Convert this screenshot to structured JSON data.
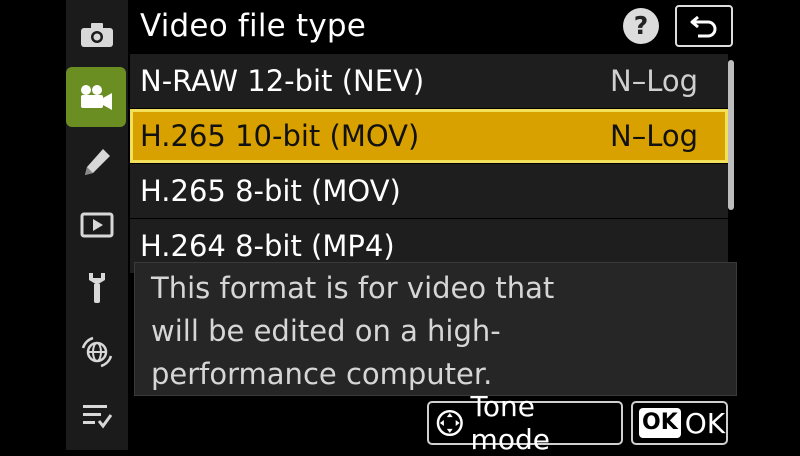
{
  "sidebar": {
    "tabs": [
      {
        "icon": "camera-icon",
        "active": false
      },
      {
        "icon": "movie-camera-icon",
        "active": true
      },
      {
        "icon": "pencil-icon",
        "active": false
      },
      {
        "icon": "playback-icon",
        "active": false
      },
      {
        "icon": "wrench-icon",
        "active": false
      },
      {
        "icon": "network-icon",
        "active": false
      },
      {
        "icon": "my-menu-icon",
        "active": false
      }
    ]
  },
  "header": {
    "title": "Video file type",
    "help_label": "?"
  },
  "options": [
    {
      "label": "N-RAW 12-bit (NEV)",
      "value": "N–Log",
      "selected": false
    },
    {
      "label": "H.265 10-bit (MOV)",
      "value": "N–Log",
      "selected": true
    },
    {
      "label": "H.265 8-bit (MOV)",
      "value": "",
      "selected": false
    },
    {
      "label": "H.264 8-bit (MP4)",
      "value": "",
      "selected": false
    }
  ],
  "help": {
    "text": "This format is for video that will be edited on a high-performance computer.",
    "line1": "This format is for video that",
    "line2": "will be edited on a high-",
    "line3": "performance computer."
  },
  "footer": {
    "tone_mode_label": "Tone mode",
    "ok_badge": "OK",
    "ok_label": "OK"
  },
  "colors": {
    "selected_bg": "#d9a100",
    "selected_border": "#f2e05a",
    "active_tab": "#6b8e23"
  }
}
